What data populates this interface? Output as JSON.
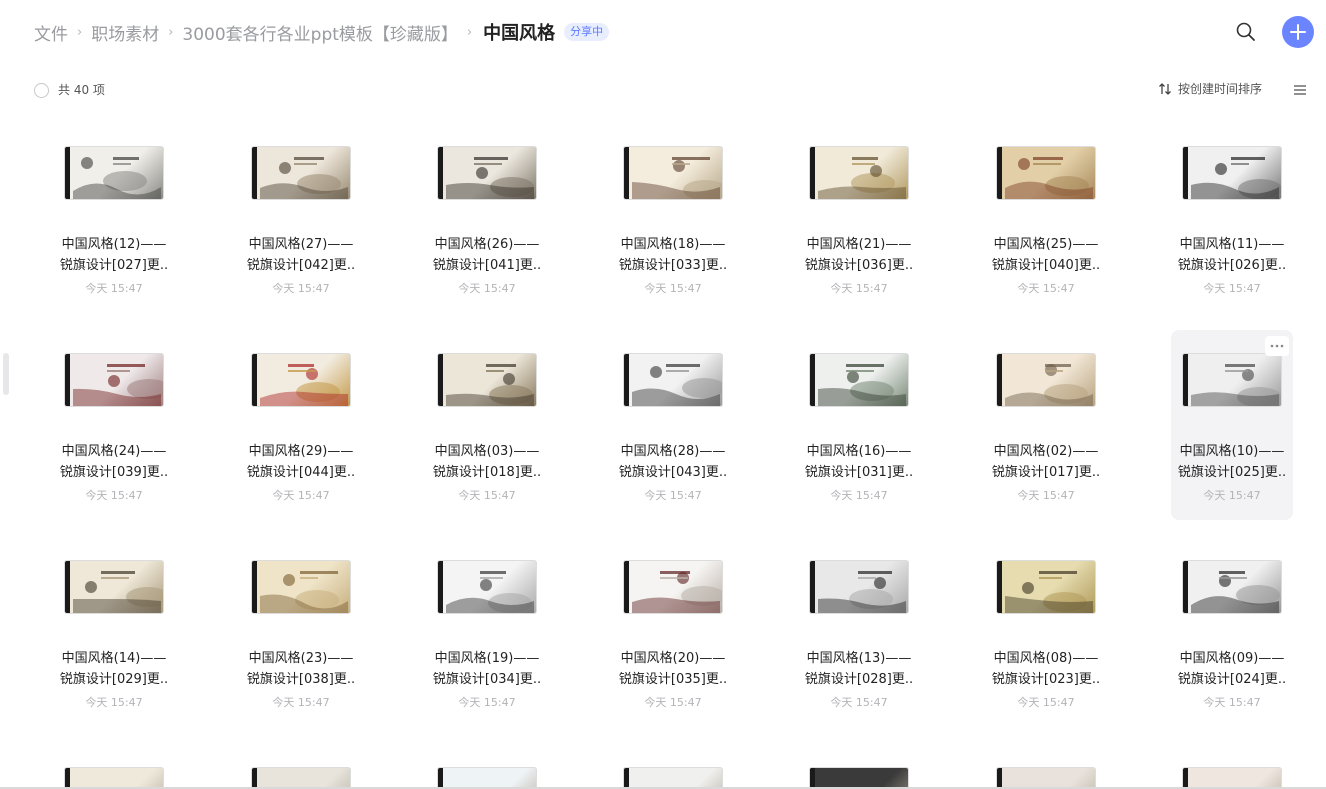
{
  "breadcrumb": {
    "items": [
      "文件",
      "职场素材",
      "3000套各行各业ppt模板【珍藏版】"
    ],
    "current": "中国风格",
    "badge": "分享中"
  },
  "header": {
    "search_icon": "search-icon",
    "add_icon": "plus-icon"
  },
  "toolbar": {
    "count": "共 40 项",
    "sort_label": "按创建时间排序",
    "sort_icon": "sort-arrows-icon",
    "view_icon": "list-view-icon"
  },
  "colors": {
    "accent": "#6a85ff",
    "badge_bg": "#e9eeff",
    "badge_text": "#5b7bff",
    "muted": "#9a9ba0"
  },
  "files": [
    {
      "line1": "中国风格(12)——",
      "line2": "锐旗设计[027]更..",
      "time": "今天 15:47"
    },
    {
      "line1": "中国风格(27)——",
      "line2": "锐旗设计[042]更..",
      "time": "今天 15:47"
    },
    {
      "line1": "中国风格(26)——",
      "line2": "锐旗设计[041]更..",
      "time": "今天 15:47"
    },
    {
      "line1": "中国风格(18)——",
      "line2": "锐旗设计[033]更..",
      "time": "今天 15:47"
    },
    {
      "line1": "中国风格(21)——",
      "line2": "锐旗设计[036]更..",
      "time": "今天 15:47"
    },
    {
      "line1": "中国风格(25)——",
      "line2": "锐旗设计[040]更..",
      "time": "今天 15:47"
    },
    {
      "line1": "中国风格(11)——",
      "line2": "锐旗设计[026]更..",
      "time": "今天 15:47"
    },
    {
      "line1": "中国风格(24)——",
      "line2": "锐旗设计[039]更..",
      "time": "今天 15:47"
    },
    {
      "line1": "中国风格(29)——",
      "line2": "锐旗设计[044]更..",
      "time": "今天 15:47"
    },
    {
      "line1": "中国风格(03)——",
      "line2": "锐旗设计[018]更..",
      "time": "今天 15:47"
    },
    {
      "line1": "中国风格(28)——",
      "line2": "锐旗设计[043]更..",
      "time": "今天 15:47"
    },
    {
      "line1": "中国风格(16)——",
      "line2": "锐旗设计[031]更..",
      "time": "今天 15:47"
    },
    {
      "line1": "中国风格(02)——",
      "line2": "锐旗设计[017]更..",
      "time": "今天 15:47"
    },
    {
      "line1": "中国风格(10)——",
      "line2": "锐旗设计[025]更..",
      "time": "今天 15:47"
    },
    {
      "line1": "中国风格(14)——",
      "line2": "锐旗设计[029]更..",
      "time": "今天 15:47"
    },
    {
      "line1": "中国风格(23)——",
      "line2": "锐旗设计[038]更..",
      "time": "今天 15:47"
    },
    {
      "line1": "中国风格(19)——",
      "line2": "锐旗设计[034]更..",
      "time": "今天 15:47"
    },
    {
      "line1": "中国风格(20)——",
      "line2": "锐旗设计[035]更..",
      "time": "今天 15:47"
    },
    {
      "line1": "中国风格(13)——",
      "line2": "锐旗设计[028]更..",
      "time": "今天 15:47"
    },
    {
      "line1": "中国风格(08)——",
      "line2": "锐旗设计[023]更..",
      "time": "今天 15:47"
    },
    {
      "line1": "中国风格(09)——",
      "line2": "锐旗设计[024]更..",
      "time": "今天 15:47"
    }
  ]
}
